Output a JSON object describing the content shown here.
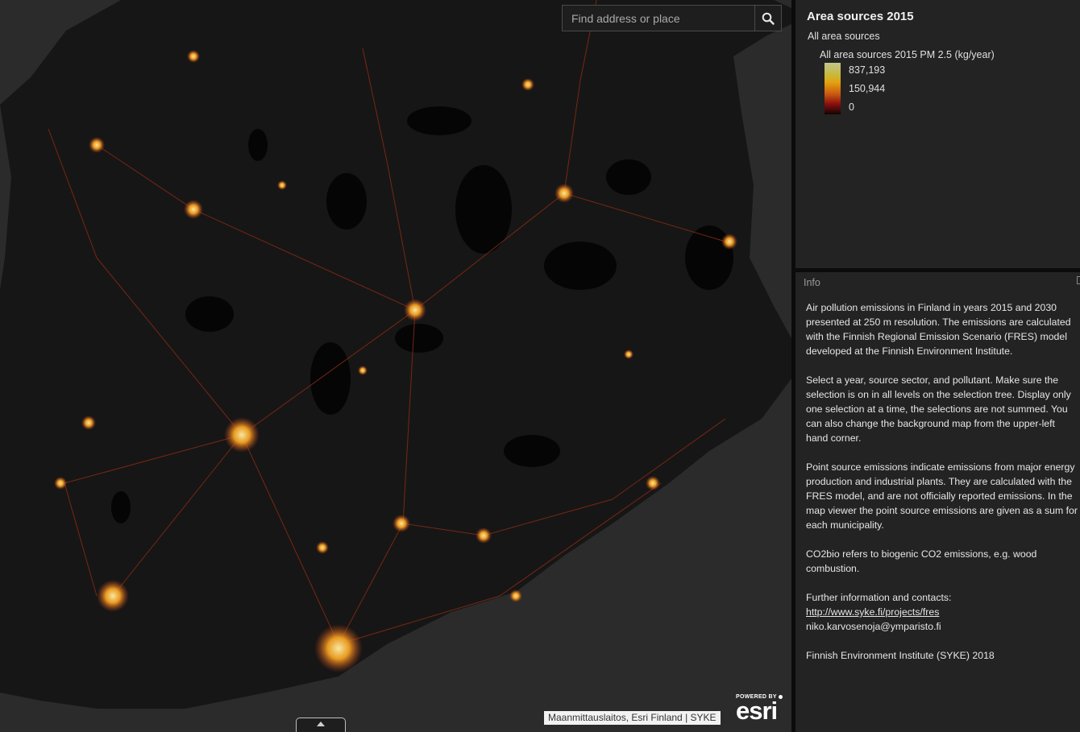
{
  "search": {
    "placeholder": "Find address or place",
    "icon": "search-icon"
  },
  "map": {
    "attribution": "Maanmittauslaitos, Esri Finland | SYKE",
    "logo_powered_by": "POWERED BY",
    "logo_word": "esri",
    "colors": {
      "background": "#2b2b2b",
      "land": "#161616",
      "water": "#050505",
      "emission_low": "#c2411a",
      "emission_mid": "#e8a020",
      "emission_high": "#f4dd86"
    }
  },
  "legend": {
    "title": "Area sources 2015",
    "layer": "All area sources",
    "field": "All area sources 2015 PM 2.5 (kg/year)",
    "values": [
      "837,193",
      "150,944",
      "0"
    ]
  },
  "info": {
    "header": "Info",
    "paragraphs": [
      "Air pollution emissions in Finland in years 2015 and 2030 presented at 250 m resolution. The emissions are calculated with the Finnish Regional Emission Scenario (FRES) model developed at the Finnish Environment Institute.",
      "Select a year, source sector, and pollutant. Make sure the selection is on in all levels on the selection tree. Display only one selection at a time, the selections are not summed. You can also change the background map from the upper-left hand corner.",
      "Point source emissions indicate emissions from major energy production and industrial plants. They are calculated with the FRES model, and are not officially reported emissions. In the map viewer the point source emissions are given as a sum for each municipality.",
      "CO2bio refers to biogenic CO2 emissions, e.g. wood combustion."
    ],
    "contacts_label": "Further information and contacts:",
    "link": "http://www.syke.fi/projects/fres",
    "email": "niko.karvosenoja@ymparisto.fi",
    "footer": "Finnish Environment Institute (SYKE) 2018"
  }
}
